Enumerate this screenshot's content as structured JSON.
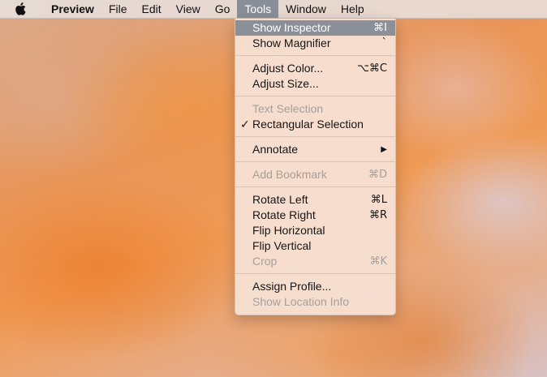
{
  "menubar": {
    "app_name": "Preview",
    "menus": [
      "File",
      "Edit",
      "View",
      "Go",
      "Tools",
      "Window",
      "Help"
    ]
  },
  "tools_menu": {
    "show_inspector": {
      "label": "Show Inspector",
      "shortcut": "⌘I"
    },
    "show_magnifier": {
      "label": "Show Magnifier",
      "shortcut": "`"
    },
    "adjust_color": {
      "label": "Adjust Color...",
      "shortcut": "⌥⌘C"
    },
    "adjust_size": {
      "label": "Adjust Size...",
      "shortcut": ""
    },
    "text_selection": {
      "label": "Text Selection",
      "shortcut": ""
    },
    "rectangular_selection": {
      "label": "Rectangular Selection",
      "shortcut": "",
      "checkmark": "✓"
    },
    "annotate": {
      "label": "Annotate",
      "arrow": "▶"
    },
    "add_bookmark": {
      "label": "Add Bookmark",
      "shortcut": "⌘D"
    },
    "rotate_left": {
      "label": "Rotate Left",
      "shortcut": "⌘L"
    },
    "rotate_right": {
      "label": "Rotate Right",
      "shortcut": "⌘R"
    },
    "flip_horizontal": {
      "label": "Flip Horizontal",
      "shortcut": ""
    },
    "flip_vertical": {
      "label": "Flip Vertical",
      "shortcut": ""
    },
    "crop": {
      "label": "Crop",
      "shortcut": "⌘K"
    },
    "assign_profile": {
      "label": "Assign Profile...",
      "shortcut": ""
    },
    "show_location_info": {
      "label": "Show Location Info",
      "shortcut": ""
    }
  },
  "colors": {
    "highlight": "#8b8f98",
    "disabled_text": "#a89e99"
  },
  "icons": {
    "apple": "apple-logo-icon",
    "check": "checkmark-icon",
    "submenu": "submenu-arrow-icon"
  }
}
